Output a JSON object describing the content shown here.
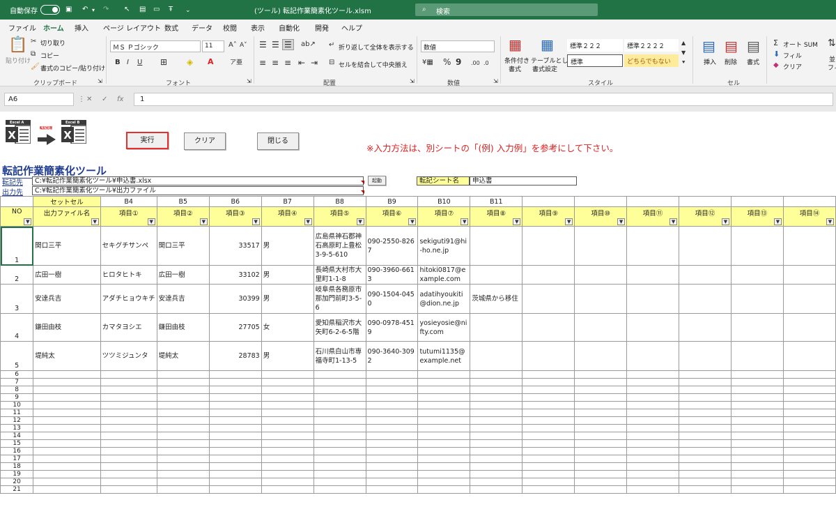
{
  "titlebar": {
    "autosave": "自動保存",
    "toggle_state": "オフ",
    "filename": "(ツール) 転記作業簡素化ツール.xlsm",
    "search_placeholder": "検索"
  },
  "menu": [
    "ファイル",
    "ホーム",
    "挿入",
    "ページ レイアウト",
    "数式",
    "データ",
    "校閲",
    "表示",
    "自動化",
    "開発",
    "ヘルプ"
  ],
  "ribbon": {
    "paste": "貼り付け",
    "cut": "切り取り",
    "copy": "コピー",
    "format_painter": "書式のコピー/貼り付け",
    "clipboard": "クリップボード",
    "font_name": "ＭＳ Ｐゴシック",
    "font_size": "11",
    "font_group": "フォント",
    "wrap_text": "折り返して全体を表示する",
    "merge_center": "セルを結合して中央揃え",
    "alignment": "配置",
    "number_format": "数値",
    "number_group": "数値",
    "cond_format_1": "条件付き",
    "cond_format_2": "書式",
    "table_format_1": "テーブルとして",
    "table_format_2": "書式設定",
    "style_1": "標準２２２",
    "style_2": "標準２２２２",
    "style_3": "標準",
    "style_4": "どちらでもない",
    "style_group": "スタイル",
    "insert": "挿入",
    "delete": "削除",
    "format": "書式",
    "cells_group": "セル",
    "autosum": "オート SUM",
    "fill": "フィル",
    "clear": "クリア",
    "sort": "並",
    "sort2": "フィ"
  },
  "formula_bar": {
    "name_box": "A6",
    "formula": "1",
    "fx": "fx"
  },
  "sheet": {
    "excel_a": "Excel A",
    "excel_b": "Excel B",
    "arrow_label": "転記処理",
    "run_button": "実行",
    "clear_button": "クリア",
    "close_button": "閉じる",
    "note": "※入力方法は、別シートの「(例) 入力例」を参考にして下さい。",
    "tool_title": "転記作業簡素化ツール",
    "src_label": "転記先",
    "src_path": "C:¥転記作業簡素化ツール¥申込書.xlsx",
    "out_label": "出力先",
    "out_path": "C:¥転記作業簡素化ツール¥出力ファイル",
    "launch_button": "起動",
    "sheet_name_label": "転記シート名",
    "sheet_name": "申込書"
  },
  "table": {
    "address_row": [
      "",
      "セットセル",
      "B4",
      "B5",
      "B6",
      "B7",
      "B8",
      "B9",
      "B10",
      "B11",
      "",
      "",
      "",
      "",
      "",
      ""
    ],
    "header_row": [
      "NO",
      "出力ファイル名",
      "項目①",
      "項目②",
      "項目③",
      "項目④",
      "項目⑤",
      "項目⑥",
      "項目⑦",
      "項目⑧",
      "項目⑨",
      "項目⑩",
      "項目⑪",
      "項目⑫",
      "項目⑬",
      "項目⑭"
    ],
    "rows": [
      {
        "no": "1",
        "name": "関口三平",
        "kana": "セキグチサンペ",
        "b5": "関口三平",
        "b6": "33517",
        "b7": "男",
        "b8": "広島県神石郡神石高原町上豊松3-9-5-610",
        "b9": "090-2550-8267",
        "b10": "sekiguti91@hi-ho.ne.jp",
        "b11": ""
      },
      {
        "no": "2",
        "name": "広田一樹",
        "kana": "ヒロタヒトキ",
        "b5": "広田一樹",
        "b6": "33102",
        "b7": "男",
        "b8": "長崎県大村市大里町1-1-8",
        "b9": "090-3960-6613",
        "b10": "hitoki0817@example.com",
        "b11": ""
      },
      {
        "no": "3",
        "name": "安達兵吉",
        "kana": "アダチヒョウキチ",
        "b5": "安達兵吉",
        "b6": "30399",
        "b7": "男",
        "b8": "岐阜県各務原市那加門前町3-5-6",
        "b9": "090-1504-0450",
        "b10": "adatihyoukiti@dion.ne.jp",
        "b11": "茨城県から移住"
      },
      {
        "no": "4",
        "name": "鎌田由枝",
        "kana": "カマタヨシエ",
        "b5": "鎌田由枝",
        "b6": "27705",
        "b7": "女",
        "b8": "愛知県稲沢市大矢町6-2-6-5階",
        "b9": "090-0978-4519",
        "b10": "yosieyosie@nifty.com",
        "b11": ""
      },
      {
        "no": "5",
        "name": "堤純太",
        "kana": "ツツミジュンタ",
        "b5": "堤純太",
        "b6": "28783",
        "b7": "男",
        "b8": "石川県白山市専福寺町1-13-5",
        "b9": "090-3640-3092",
        "b10": "tutumi1135@example.net",
        "b11": ""
      }
    ],
    "empty_rows": [
      "6",
      "7",
      "8",
      "9",
      "10",
      "11",
      "12",
      "13",
      "14",
      "15",
      "16",
      "17",
      "18",
      "19",
      "20",
      "21"
    ]
  }
}
